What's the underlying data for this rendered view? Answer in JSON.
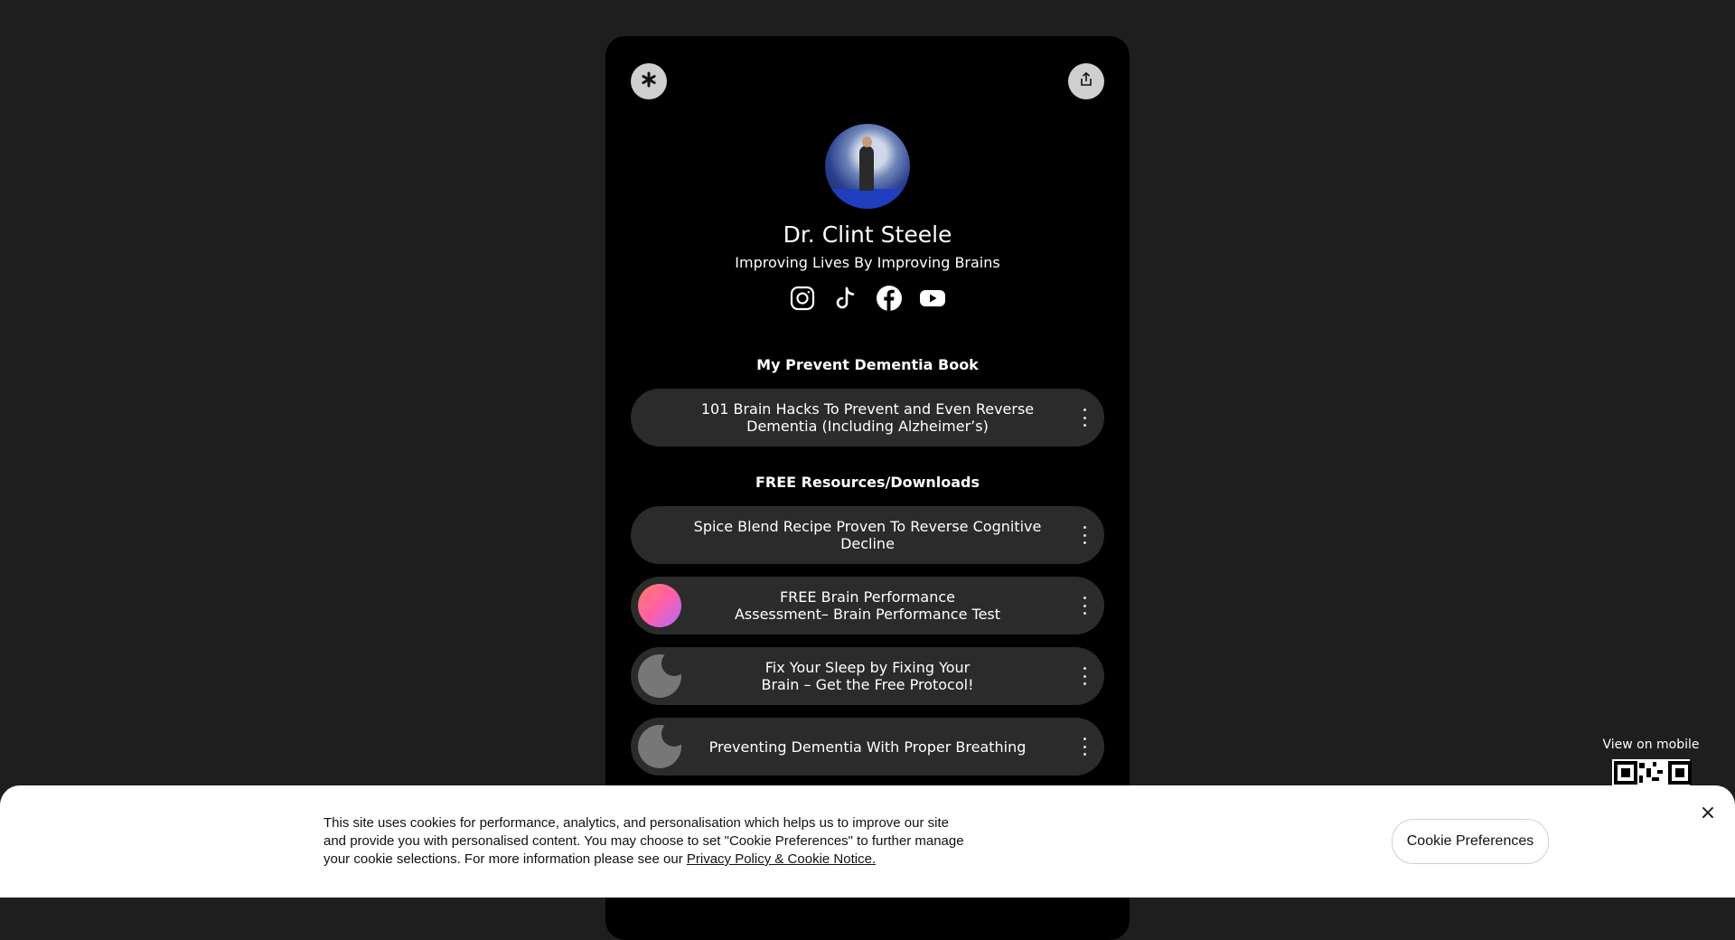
{
  "profile": {
    "name": "Dr. Clint Steele",
    "tagline": "Improving Lives By Improving Brains"
  },
  "header": {
    "left_icon": "asterisk-icon",
    "right_icon": "share-icon"
  },
  "socials": [
    {
      "icon": "instagram-icon"
    },
    {
      "icon": "tiktok-icon"
    },
    {
      "icon": "facebook-icon"
    },
    {
      "icon": "youtube-icon"
    }
  ],
  "sections": [
    {
      "title": "My Prevent Dementia Book",
      "links": [
        {
          "label": "101 Brain Hacks To Prevent and Even Reverse Dementia (Including Alzheimer’s)"
        }
      ]
    },
    {
      "title": "FREE Resources/Downloads",
      "links": [
        {
          "label": "Spice Blend Recipe Proven To Reverse Cognitive Decline"
        },
        {
          "label": "FREE Brain Performance Assessment– Brain Performance Test"
        },
        {
          "label": "Fix Your Sleep by Fixing Your Brain – Get the Free Protocol!"
        },
        {
          "label": "Preventing Dementia With Proper Breathing"
        }
      ]
    }
  ],
  "mobile": {
    "label": "View on mobile"
  },
  "cookie": {
    "text": "This site uses cookies for performance, analytics, and personalisation which helps us to improve our site and provide you with personalised content. You may choose to set \"Cookie Preferences\" to further manage your cookie selections. For more information please see our ",
    "link_label": "Privacy Policy & Cookie Notice.",
    "button_label": "Cookie Preferences",
    "close_label": "×"
  }
}
